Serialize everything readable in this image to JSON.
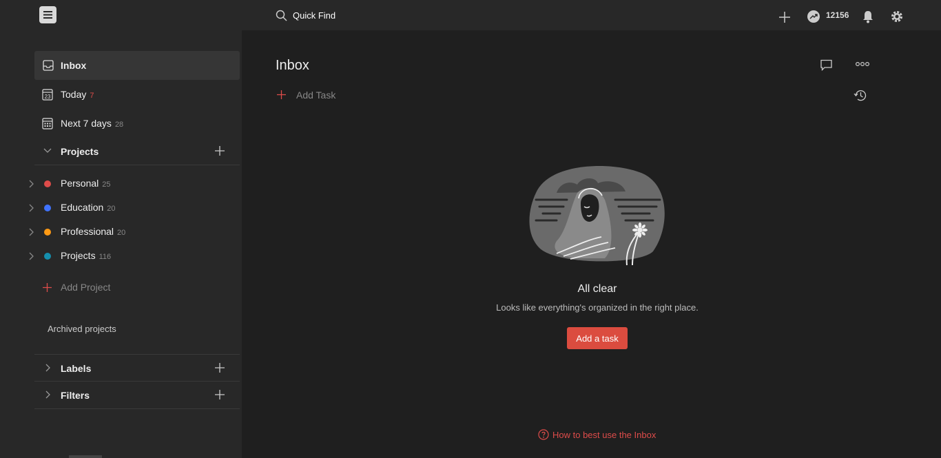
{
  "topbar": {
    "search_label": "Quick Find",
    "karma_count": "12156",
    "icons": [
      "app-logo-icon",
      "search-icon",
      "plus-icon",
      "karma-icon",
      "bell-icon",
      "gear-icon"
    ]
  },
  "sidebar": {
    "nav": [
      {
        "label": "Inbox",
        "count": ""
      },
      {
        "label": "Today",
        "count": "7"
      },
      {
        "label": "Next 7 days",
        "count": "28"
      }
    ],
    "projects_title": "Projects",
    "projects": [
      {
        "name": "Personal",
        "count": "25",
        "color": "#de4c4a"
      },
      {
        "name": "Education",
        "count": "20",
        "color": "#4073ff"
      },
      {
        "name": "Professional",
        "count": "20",
        "color": "#ff9a14"
      },
      {
        "name": "Projects",
        "count": "116",
        "color": "#158fad"
      }
    ],
    "add_project_label": "Add Project",
    "archived_label": "Archived projects",
    "labels_title": "Labels",
    "filters_title": "Filters"
  },
  "main": {
    "title": "Inbox",
    "add_task_label": "Add Task",
    "empty_title": "All clear",
    "empty_subtitle": "Looks like everything's organized in the right place.",
    "add_task_button": "Add a task",
    "help_link": "How to best use the Inbox"
  },
  "colors": {
    "accent": "#db4c3f",
    "background": "#1f1f1f",
    "sidebar": "#282828"
  }
}
